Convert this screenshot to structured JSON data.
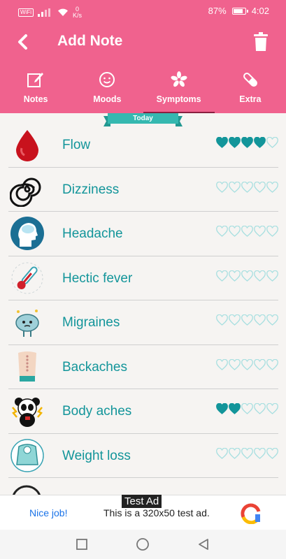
{
  "status": {
    "network": "WiFi",
    "speed_value": "0",
    "speed_unit": "K/s",
    "battery": "87%",
    "battery_level": 0.87,
    "time": "4:02"
  },
  "header": {
    "title": "Add Note"
  },
  "tabs": [
    {
      "label": "Notes",
      "icon": "edit-note-icon"
    },
    {
      "label": "Moods",
      "icon": "mood-smiley-icon"
    },
    {
      "label": "Symptoms",
      "icon": "asterisk-icon",
      "active": true
    },
    {
      "label": "Extra",
      "icon": "pill-icon"
    }
  ],
  "today_label": "Today",
  "symptoms": [
    {
      "label": "Flow",
      "rating": 4,
      "icon": "blood-drop-icon"
    },
    {
      "label": "Dizziness",
      "rating": 0,
      "icon": "spiral-icon"
    },
    {
      "label": "Headache",
      "rating": 0,
      "icon": "brain-head-icon"
    },
    {
      "label": "Hectic fever",
      "rating": 0,
      "icon": "thermometer-icon"
    },
    {
      "label": "Migraines",
      "rating": 0,
      "icon": "brain-character-icon"
    },
    {
      "label": "Backaches",
      "rating": 0,
      "icon": "back-spine-icon"
    },
    {
      "label": "Body aches",
      "rating": 2,
      "icon": "panda-icon"
    },
    {
      "label": "Weight loss",
      "rating": 0,
      "icon": "scale-icon"
    }
  ],
  "ad": {
    "tag": "Test Ad",
    "nice": "Nice job!",
    "text": "This is a 320x50 test ad."
  },
  "colors": {
    "pink": "#f0628e",
    "teal": "#13959a",
    "heart": "#13959a"
  }
}
